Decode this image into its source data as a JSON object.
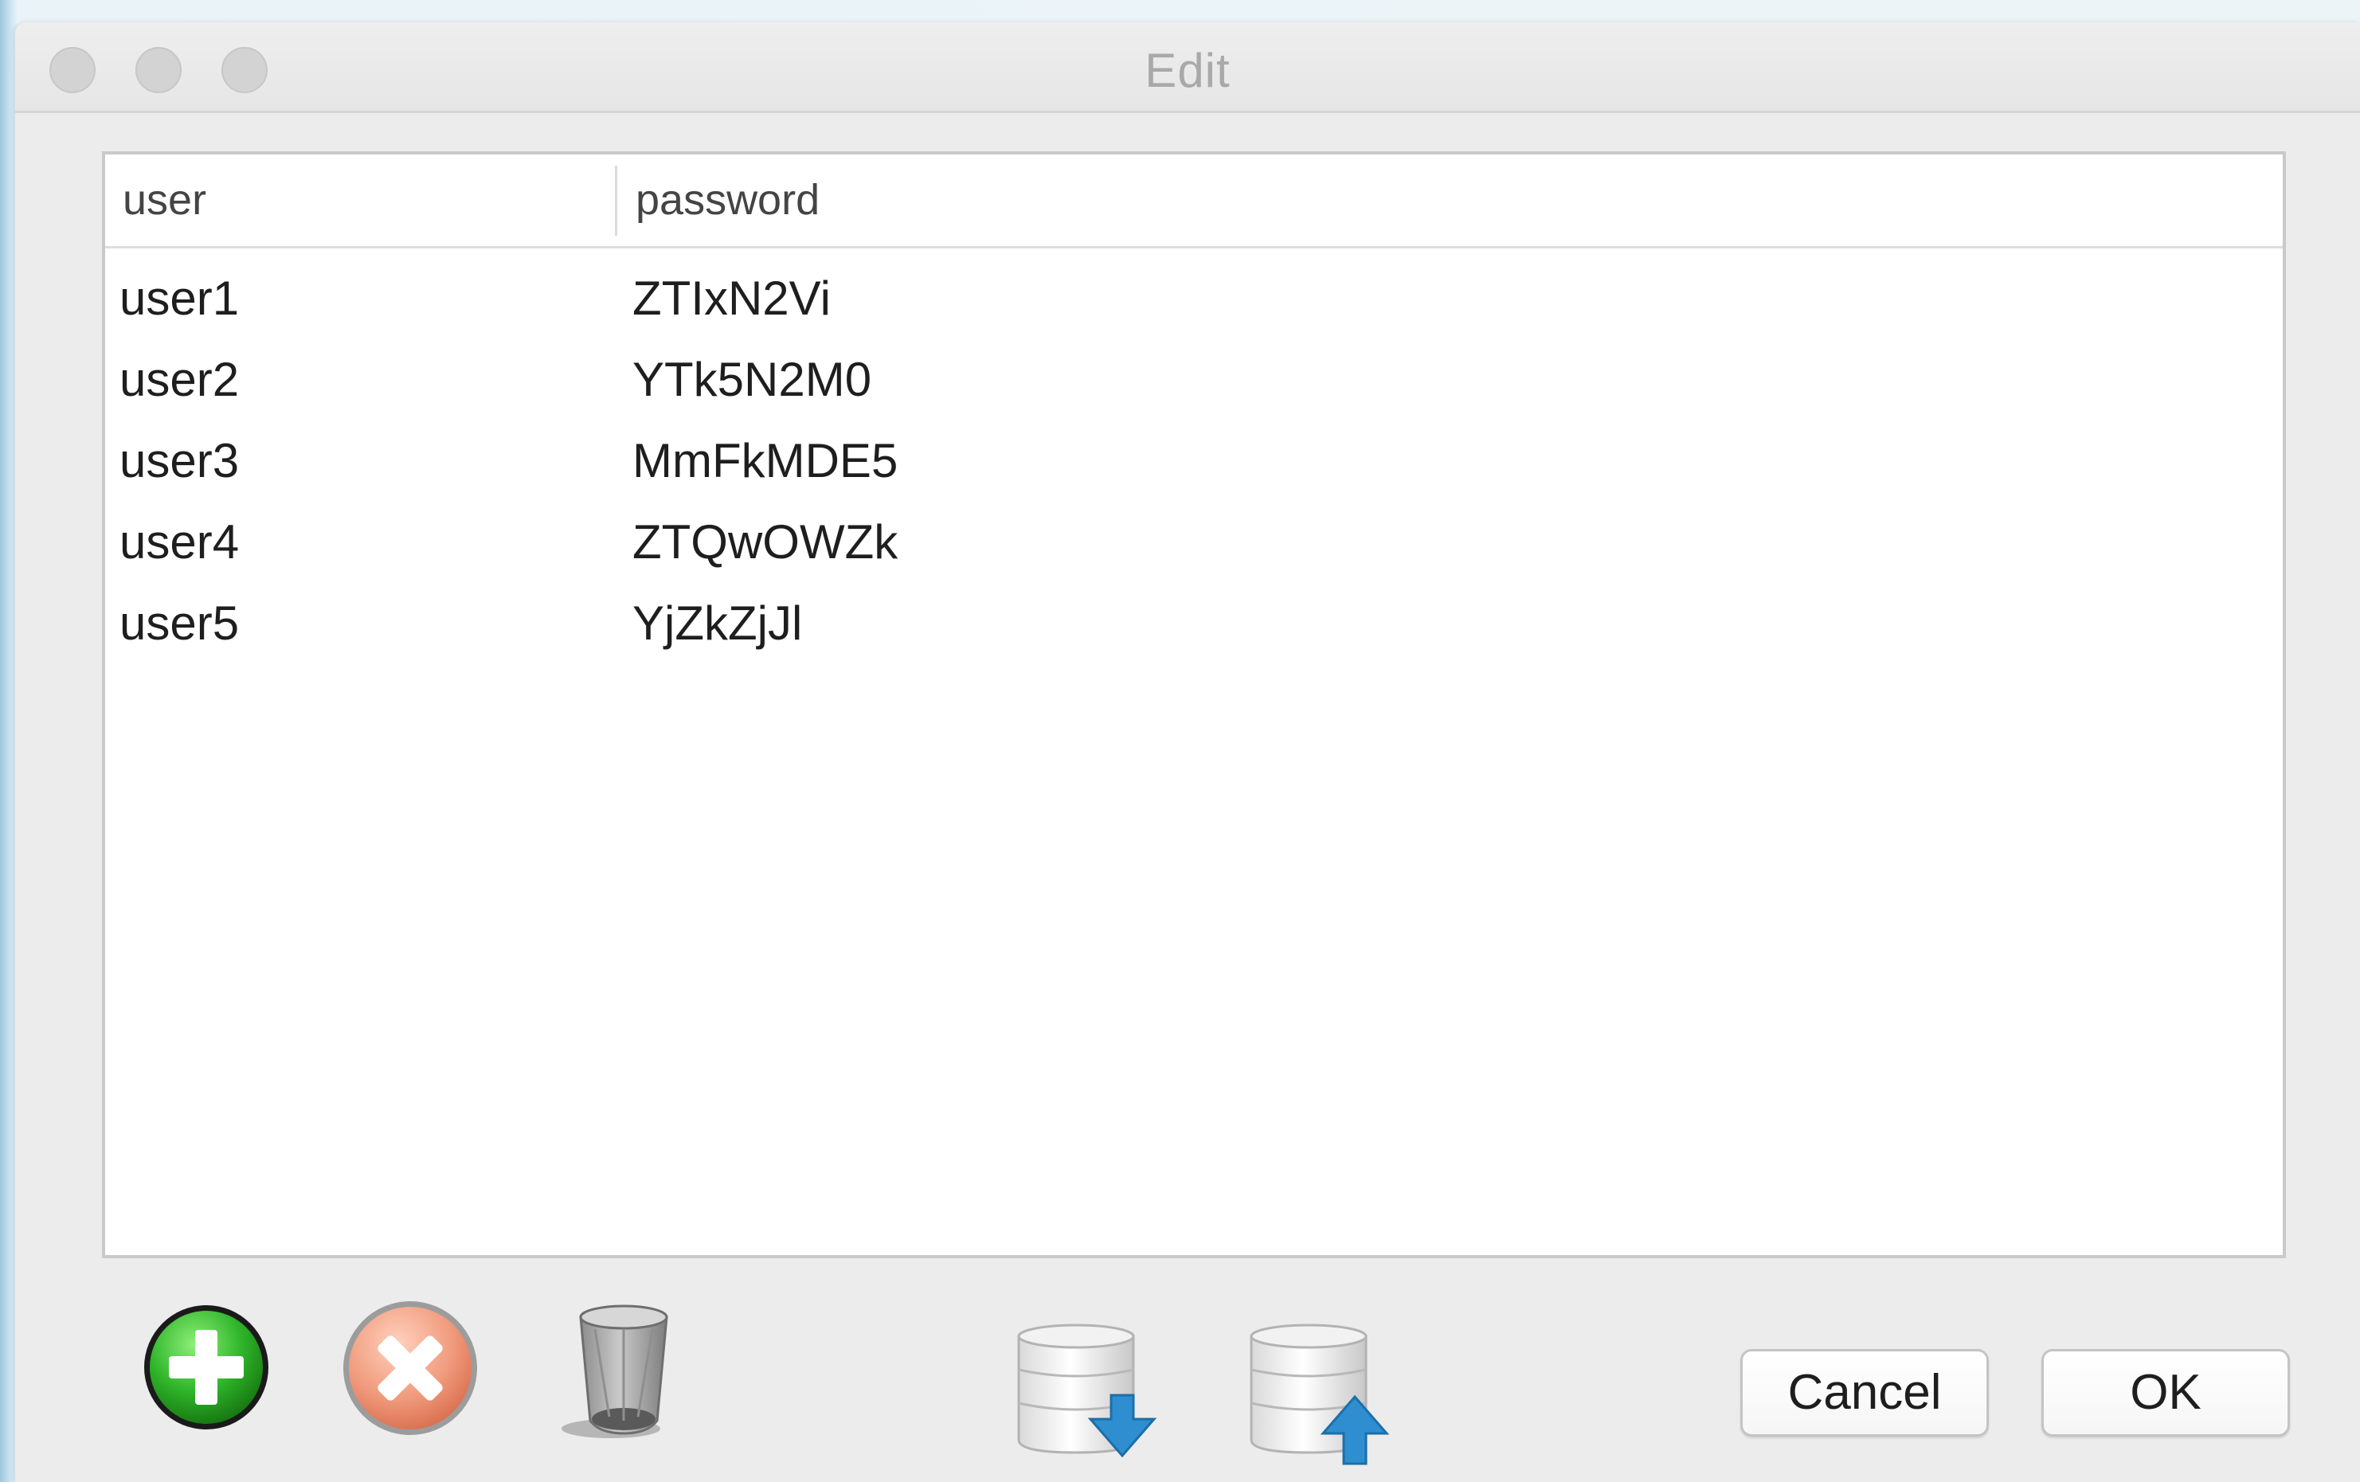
{
  "window": {
    "title": "Edit"
  },
  "table": {
    "columns": [
      "user",
      "password"
    ],
    "rows": [
      {
        "user": "user1",
        "password": "ZTIxN2Vi"
      },
      {
        "user": "user2",
        "password": "YTk5N2M0"
      },
      {
        "user": "user3",
        "password": "MmFkMDE5"
      },
      {
        "user": "user4",
        "password": "ZTQwOWZk"
      },
      {
        "user": "user5",
        "password": "YjZkZjJl"
      }
    ]
  },
  "toolbar": {
    "icons": [
      "add-icon",
      "remove-icon",
      "trash-icon",
      "database-download-icon",
      "database-upload-icon"
    ]
  },
  "buttons": {
    "cancel_label": "Cancel",
    "ok_label": "OK"
  },
  "colors": {
    "add_green": "#2fb52a",
    "remove_salmon": "#f09a7c",
    "arrow_blue": "#2e8ed0"
  }
}
